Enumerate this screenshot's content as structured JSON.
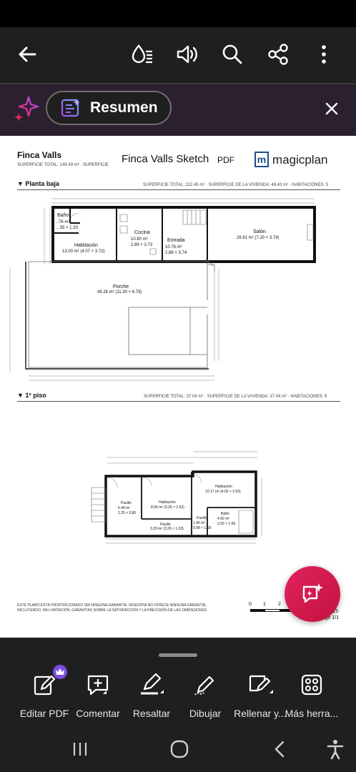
{
  "toolbar": {
    "icons": [
      "back-arrow-icon",
      "read-aloud-icon",
      "volume-icon",
      "search-icon",
      "share-icon",
      "more-vertical-icon"
    ]
  },
  "summary_bar": {
    "label": "Resumen",
    "icons": [
      "ai-sparkle-icon",
      "summary-icon",
      "close-icon"
    ]
  },
  "document": {
    "project_title": "Finca Valls",
    "sketch_title": "Finca Valls Sketch",
    "pdf_tag": "PDF",
    "brand_m": "m",
    "brand": "magicplan",
    "total_area": "SUPERFICIE TOTAL: 149.49 m² · SUPERFICIE",
    "floors": [
      {
        "name": "Planta baja",
        "stats": "SUPERFICIE TOTAL: 112.45 m² · SUPERFICIE DE LA VIVIENDA: 48.43 m² · HABITACIONES: 5",
        "rooms": [
          {
            "name": "Baño",
            "dims": "...76 m²\n... 35 × 1.33"
          },
          {
            "name": "Habitación",
            "dims": "13.00 m² (4.07 × 3.72)"
          },
          {
            "name": "Cocina",
            "dims": "10.80 m²\n2.89 × 3.73"
          },
          {
            "name": "Entrada",
            "dims": "10.76 m²\n2.88 × 3.74"
          },
          {
            "name": "Salón",
            "dims": "26.91 m² (7.20 × 3.74)"
          },
          {
            "name": "Porche",
            "dims": "49.26 m² (11.30 × 6.79)"
          }
        ]
      },
      {
        "name": "1º piso",
        "stats": "SUPERFICIE TOTAL: 37.04 m² · SUPERFICIE DE LA VIVIENDA: 37.04 m² · HABITACIONES: 6",
        "rooms": [
          {
            "name": "Pasillo",
            "dims": "5.48 m²\n2.25 × 3.80"
          },
          {
            "name": "Habitación",
            "dims": "8.56 m² (3.26 × 2.62)"
          },
          {
            "name": "Pasillo",
            "dims": "3.29 m² (3.26 × 1.03)"
          },
          {
            "name": "Pasillo",
            "dims": "1.45 m²\n0.98 × 1.68"
          },
          {
            "name": "Baño",
            "dims": "4.92 m²\n2.92 × 1.69"
          },
          {
            "name": "Habitación",
            "dims": "10.17 m² (4.02 × 2.53)"
          }
        ]
      }
    ],
    "disclaimer": "ESTE PLANO ESTÁ PROPORCIONADO SIN NINGUNA GARANTÍA. SENSOPIA NO OFRECE NINGUNA GARANTÍA,\nINCLUYENDO, SIN LIMITACIÓN, GARANTÍAS SOBRE LA SATISFACCIÓN Y LA PRECISIÓN DE LAS DIMENSIONES",
    "scale_ticks": [
      "0",
      "1",
      "2"
    ],
    "scale_suffix": "115",
    "page_label": "Page 1/1"
  },
  "bottom_tools": [
    {
      "label": "Editar PDF",
      "icon": "edit-pdf-icon",
      "premium": true
    },
    {
      "label": "Comentar",
      "icon": "comment-icon"
    },
    {
      "label": "Resaltar",
      "icon": "highlight-icon"
    },
    {
      "label": "Dibujar",
      "icon": "draw-icon"
    },
    {
      "label": "Rellenar y...",
      "icon": "fill-sign-icon"
    },
    {
      "label": "Más herra...",
      "icon": "more-tools-icon"
    }
  ],
  "nav": {
    "icons": [
      "recent-apps-icon",
      "home-icon",
      "back-icon",
      "accessibility-icon"
    ]
  },
  "colors": {
    "fab": "#d41a4f",
    "premium_badge": "#7b4de0",
    "summary_bg": "#2a2030"
  }
}
